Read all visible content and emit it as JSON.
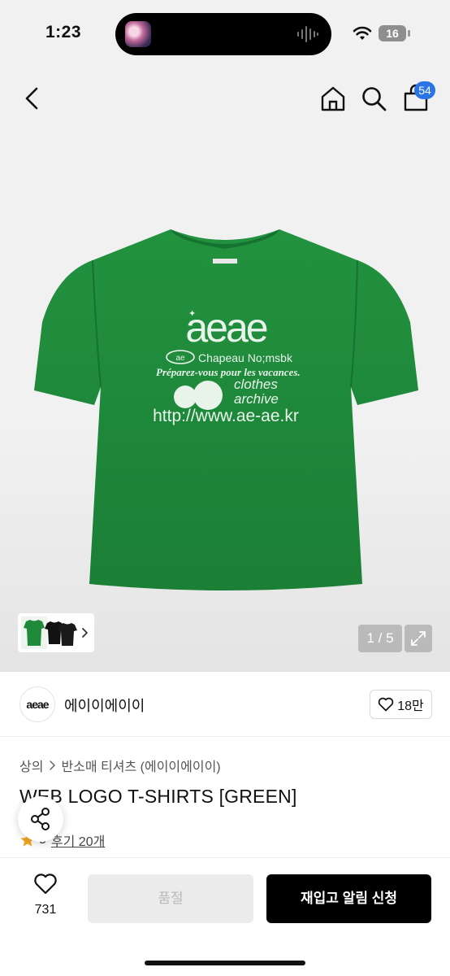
{
  "status_bar": {
    "time": "1:23",
    "battery": "16"
  },
  "nav": {
    "cart_count": "54",
    "icons": [
      "back-arrow-icon",
      "home-icon",
      "search-icon",
      "shopping-bag-icon"
    ]
  },
  "gallery": {
    "page_indicator": "1 / 5",
    "shirt_print": {
      "logo": "aeae",
      "line_1": "Chapeau No;msbk",
      "line_2": "Préparez-vous pour les vacances.",
      "line_3": "clothes",
      "line_4": "archive",
      "url": "http://www.ae-ae.kr"
    },
    "shirt_color": "#1f8a3a"
  },
  "brand": {
    "logo_text": "aeae",
    "name": "에이이에이이",
    "likes": "18만"
  },
  "breadcrumb": [
    "상의",
    "반소매 티셔츠 (에이이에이이)"
  ],
  "product": {
    "title": "WEB LOGO T-SHIRTS [GREEN]",
    "rating": "5",
    "reviews": "후기 20개"
  },
  "bottom_bar": {
    "wish_count": "731",
    "soldout_label": "품절",
    "restock_label": "재입고 알림 신청"
  },
  "colors": {
    "accent": "#2a74e6",
    "star": "#f5a623",
    "primary_button": "#000000"
  }
}
